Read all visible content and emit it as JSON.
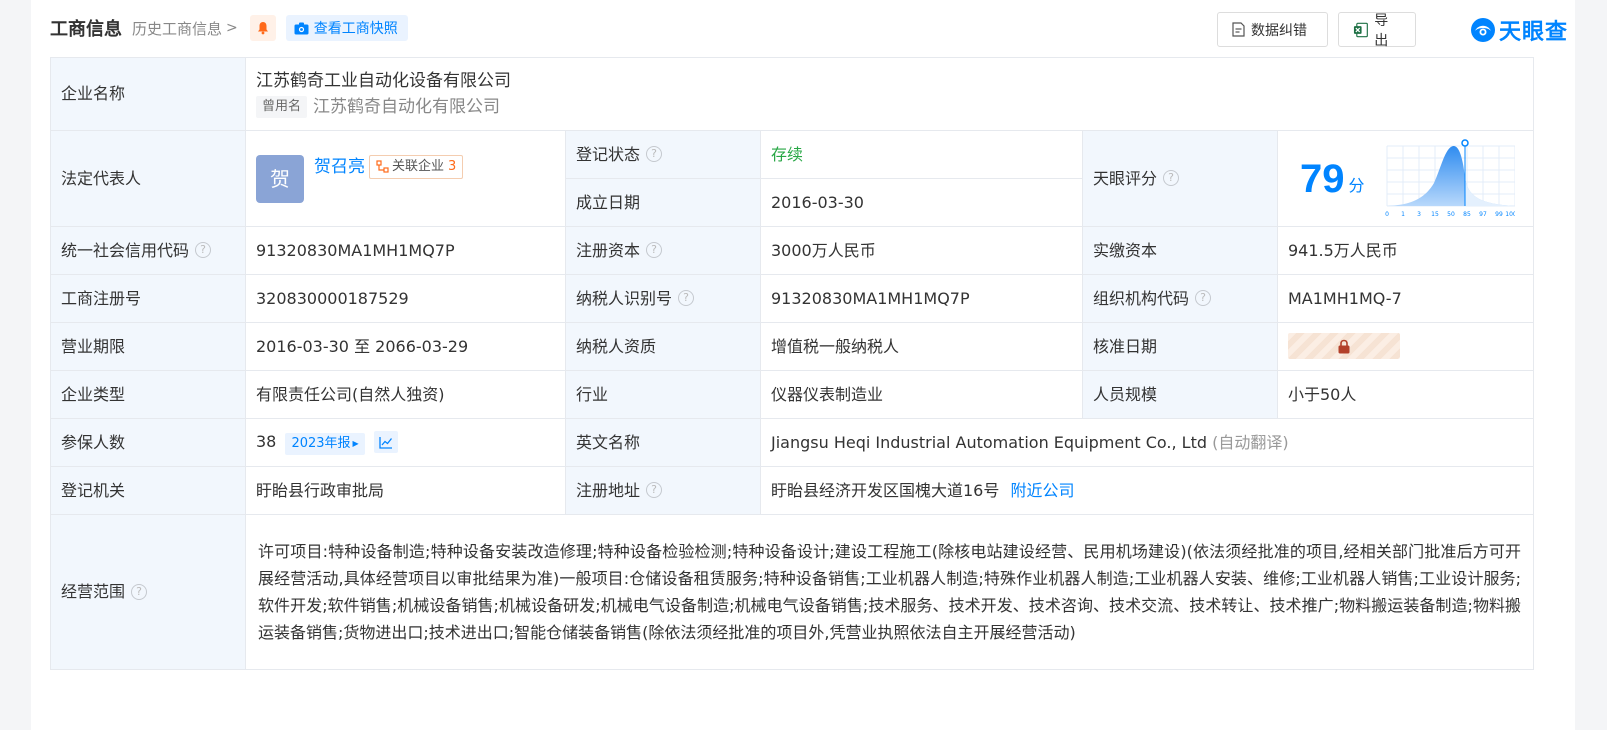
{
  "header": {
    "title": "工商信息",
    "history_label": "历史工商信息",
    "snapshot_label": "查看工商快照",
    "correction_label": "数据纠错",
    "export_label": "导出",
    "logo_text": "天眼查"
  },
  "company": {
    "name_label": "企业名称",
    "name": "江苏鹤奇工业自动化设备有限公司",
    "former_tag": "曾用名",
    "former_name": "江苏鹤奇自动化有限公司",
    "legal_rep_label": "法定代表人",
    "legal_rep_avatar": "贺",
    "legal_rep_name": "贺召亮",
    "related_label": "关联企业",
    "related_count": "3",
    "reg_status_label": "登记状态",
    "reg_status": "存续",
    "found_date_label": "成立日期",
    "found_date": "2016-03-30",
    "score_label": "天眼评分",
    "score": "79",
    "score_unit": "分",
    "score_axis": [
      "0",
      "1",
      "3",
      "15",
      "50",
      "85",
      "97",
      "99",
      "100"
    ],
    "credit_code_label": "统一社会信用代码",
    "credit_code": "91320830MA1MH1MQ7P",
    "reg_capital_label": "注册资本",
    "reg_capital": "3000万人民币",
    "paid_capital_label": "实缴资本",
    "paid_capital": "941.5万人民币",
    "biz_reg_no_label": "工商注册号",
    "biz_reg_no": "320830000187529",
    "taxpayer_id_label": "纳税人识别号",
    "taxpayer_id": "91320830MA1MH1MQ7P",
    "org_code_label": "组织机构代码",
    "org_code": "MA1MH1MQ-7",
    "term_label": "营业期限",
    "term": "2016-03-30 至 2066-03-29",
    "tax_quality_label": "纳税人资质",
    "tax_quality": "增值税一般纳税人",
    "approve_date_label": "核准日期",
    "type_label": "企业类型",
    "type": "有限责任公司(自然人独资)",
    "industry_label": "行业",
    "industry": "仪器仪表制造业",
    "staff_size_label": "人员规模",
    "staff_size": "小于50人",
    "insured_label": "参保人数",
    "insured": "38",
    "annual_report": "2023年报",
    "en_name_label": "英文名称",
    "en_name": "Jiangsu Heqi Industrial Automation Equipment Co., Ltd",
    "auto_translate": "(自动翻译)",
    "authority_label": "登记机关",
    "authority": "盱眙县行政审批局",
    "address_label": "注册地址",
    "address": "盱眙县经济开发区国槐大道16号",
    "nearby_label": "附近公司",
    "scope_label": "经营范围",
    "scope": "许可项目:特种设备制造;特种设备安装改造修理;特种设备检验检测;特种设备设计;建设工程施工(除核电站建设经营、民用机场建设)(依法须经批准的项目,经相关部门批准后方可开展经营活动,具体经营项目以审批结果为准)一般项目:仓储设备租赁服务;特种设备销售;工业机器人制造;特殊作业机器人制造;工业机器人安装、维修;工业机器人销售;工业设计服务;软件开发;软件销售;机械设备销售;机械设备研发;机械电气设备制造;机械电气设备销售;技术服务、技术开发、技术咨询、技术交流、技术转让、技术推广;物料搬运装备制造;物料搬运装备销售;货物进出口;技术进出口;智能仓储装备销售(除依法须经批准的项目外,凭营业执照依法自主开展经营活动)"
  },
  "colors": {
    "accent": "#0084ff",
    "status_green": "#28a745",
    "label_bg": "#f2f7fd",
    "border": "#e6e9ee",
    "orange": "#ff6a1a"
  }
}
